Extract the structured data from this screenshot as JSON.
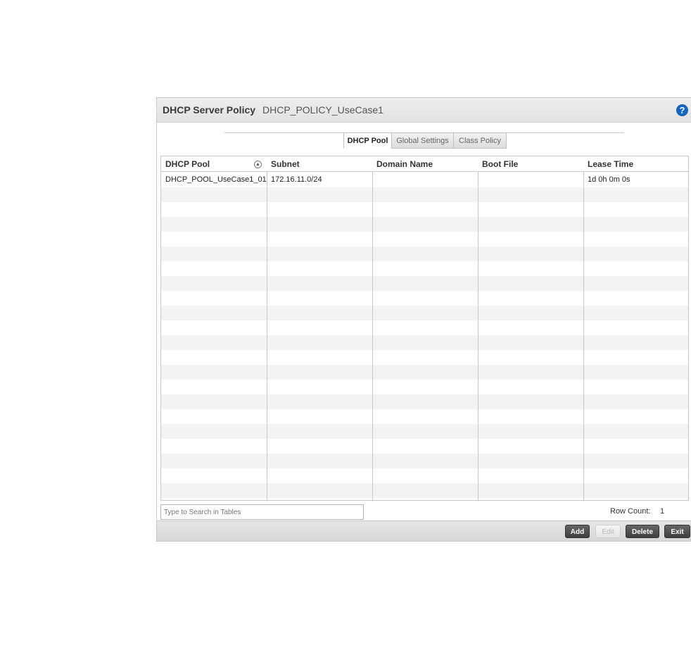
{
  "header": {
    "title": "DHCP Server Policy",
    "policy_name": "DHCP_POLICY_UseCase1",
    "help_icon": "question-circle-icon",
    "help_glyph": "?"
  },
  "tabs": [
    {
      "label": "DHCP Pool",
      "active": true
    },
    {
      "label": "Global Settings",
      "active": false
    },
    {
      "label": "Class Policy",
      "active": false
    }
  ],
  "table": {
    "columns": [
      "DHCP Pool",
      "Subnet",
      "Domain Name",
      "Boot File",
      "Lease Time"
    ],
    "sort_icon_glyph": "▲",
    "rows": [
      [
        "DHCP_POOL_UseCase1_01",
        "172.16.11.0/24",
        "",
        "",
        "1d 0h 0m 0s"
      ]
    ]
  },
  "search": {
    "placeholder": "Type to Search in Tables"
  },
  "row_count": {
    "label": "Row Count:",
    "value": "1"
  },
  "buttons": {
    "add": "Add",
    "edit": "Edit",
    "delete": "Delete",
    "exit": "Exit"
  },
  "colors": {
    "accent_help": "#1565c0",
    "button_dark": "#4a4a4a"
  }
}
